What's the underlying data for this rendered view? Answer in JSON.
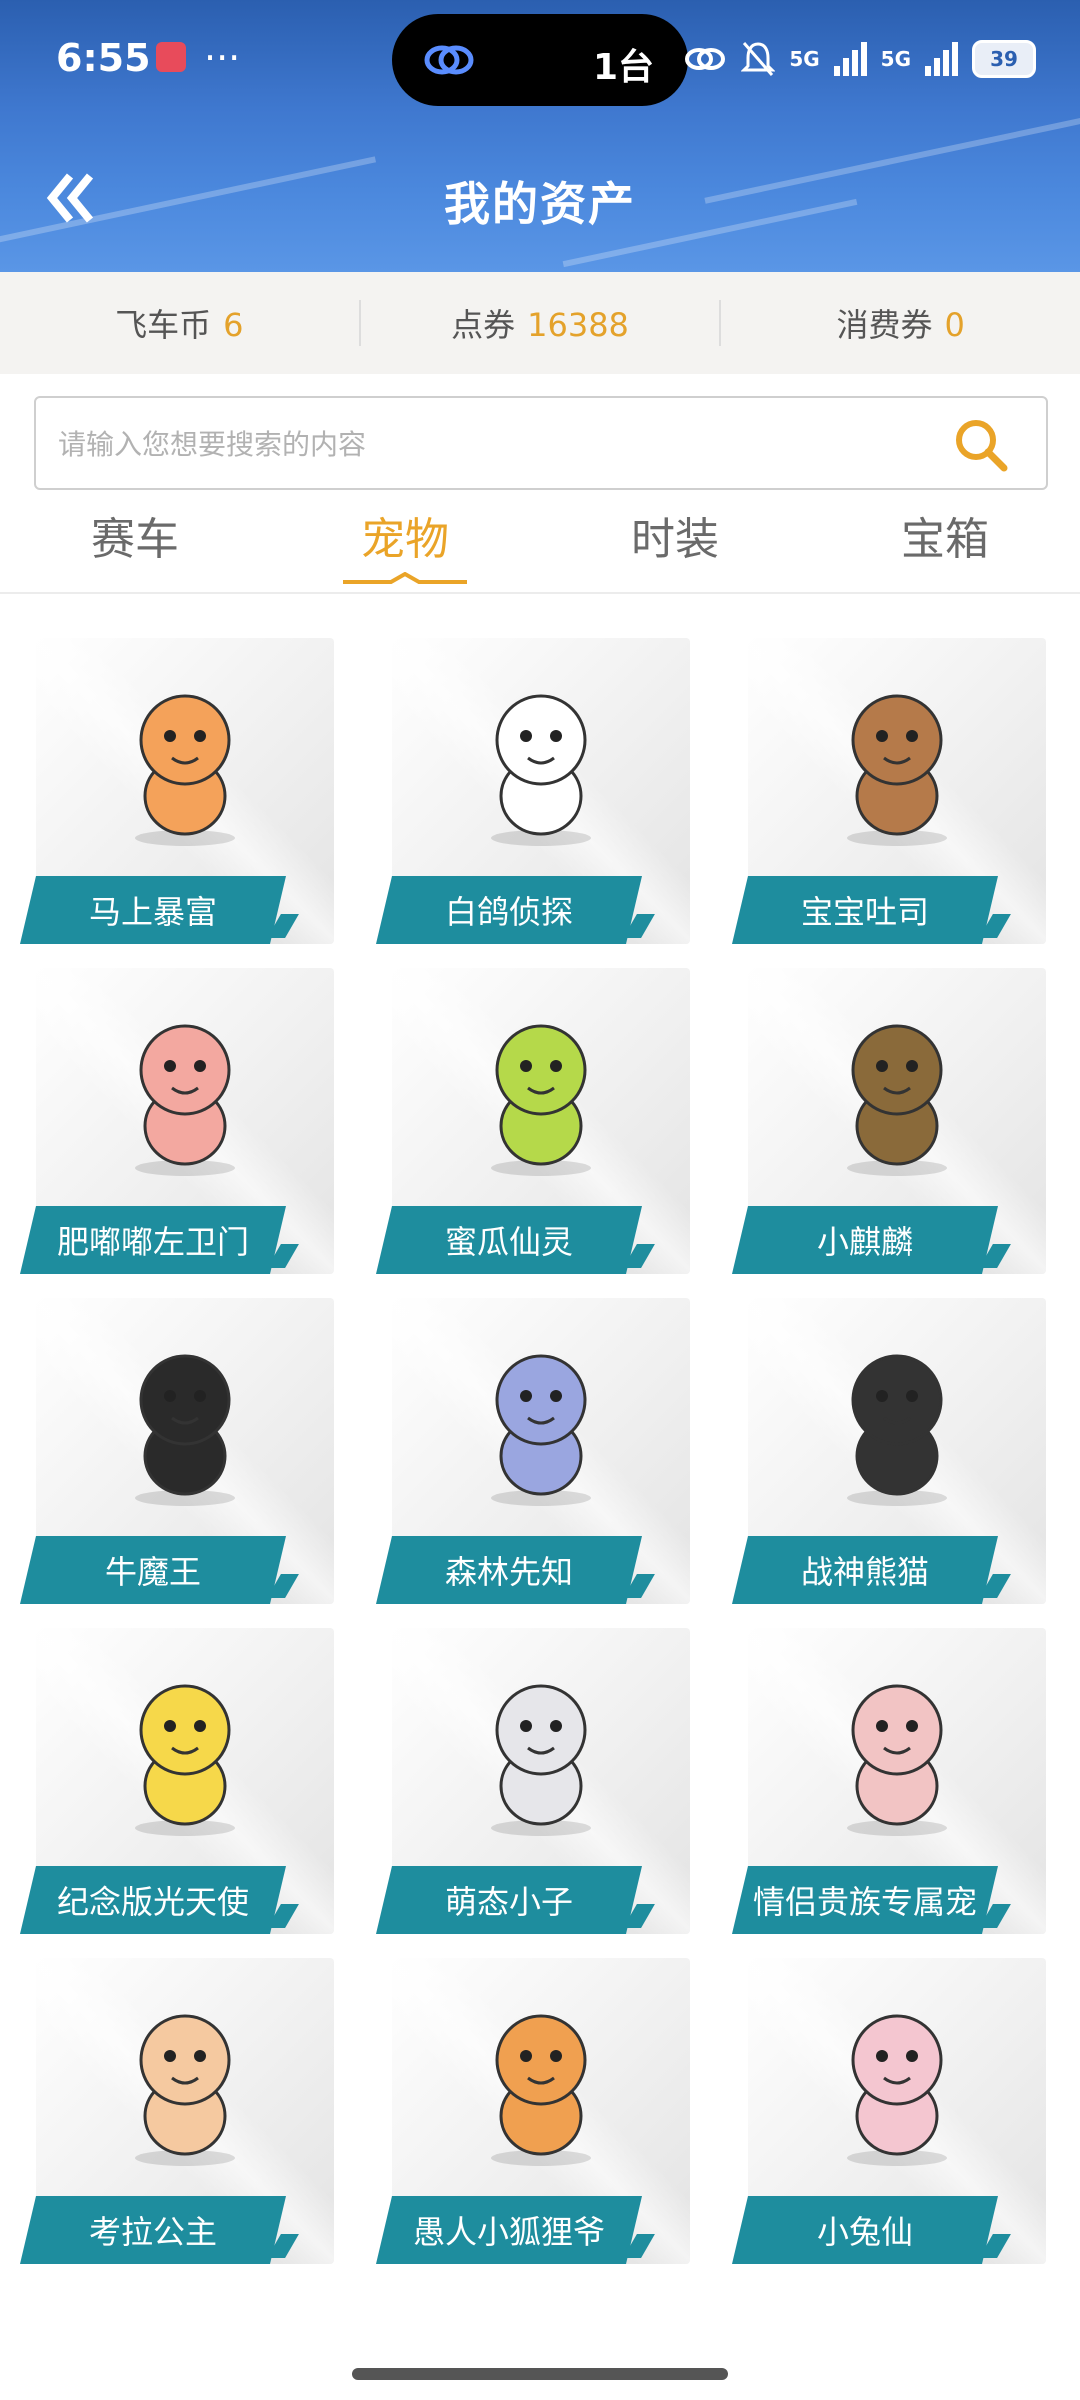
{
  "status_bar": {
    "time": "6:55",
    "more": "···",
    "island_count": "1台",
    "network_1": "5G",
    "network_2": "5G",
    "battery": "39"
  },
  "header": {
    "title": "我的资产"
  },
  "currency": [
    {
      "label": "飞车币",
      "value": "6"
    },
    {
      "label": "点券",
      "value": "16388"
    },
    {
      "label": "消费券",
      "value": "0"
    }
  ],
  "search": {
    "placeholder": "请输入您想要搜索的内容",
    "value": ""
  },
  "tabs": [
    {
      "label": "赛车",
      "active": false
    },
    {
      "label": "宠物",
      "active": true
    },
    {
      "label": "时装",
      "active": false
    },
    {
      "label": "宝箱",
      "active": false
    }
  ],
  "pets": [
    {
      "name": "马上暴富",
      "icon": "pony-icon",
      "color": "#f4a25a"
    },
    {
      "name": "白鸽侦探",
      "icon": "pigeon-detective-icon",
      "color": "#ffffff"
    },
    {
      "name": "宝宝吐司",
      "icon": "toast-icon",
      "color": "#b57a4a"
    },
    {
      "name": "肥嘟嘟左卫门",
      "icon": "pig-icon",
      "color": "#f3a8a0"
    },
    {
      "name": "蜜瓜仙灵",
      "icon": "melon-icon",
      "color": "#b5d94a"
    },
    {
      "name": "小麒麟",
      "icon": "qilin-icon",
      "color": "#8a6a3a"
    },
    {
      "name": "牛魔王",
      "icon": "bull-demon-icon",
      "color": "#2a2a2a"
    },
    {
      "name": "森林先知",
      "icon": "forest-cat-icon",
      "color": "#9aa6e0"
    },
    {
      "name": "战神熊猫",
      "icon": "panda-icon",
      "color": "#333333"
    },
    {
      "name": "纪念版光天使",
      "icon": "angel-icon",
      "color": "#f6d84a"
    },
    {
      "name": "萌态小子",
      "icon": "sleepy-boy-icon",
      "color": "#e6e6ea"
    },
    {
      "name": "情侣贵族专属宠",
      "icon": "girl-icon",
      "color": "#f2c4c4"
    },
    {
      "name": "考拉公主",
      "icon": "koala-icon",
      "color": "#f5c9a0"
    },
    {
      "name": "愚人小狐狸爷",
      "icon": "fox-icon",
      "color": "#f0a050"
    },
    {
      "name": "小兔仙",
      "icon": "rabbit-icon",
      "color": "#f4c6d0"
    }
  ],
  "colors": {
    "accent": "#eaa428",
    "label_bg": "#1e8d9e",
    "header": "#3f78cf"
  }
}
